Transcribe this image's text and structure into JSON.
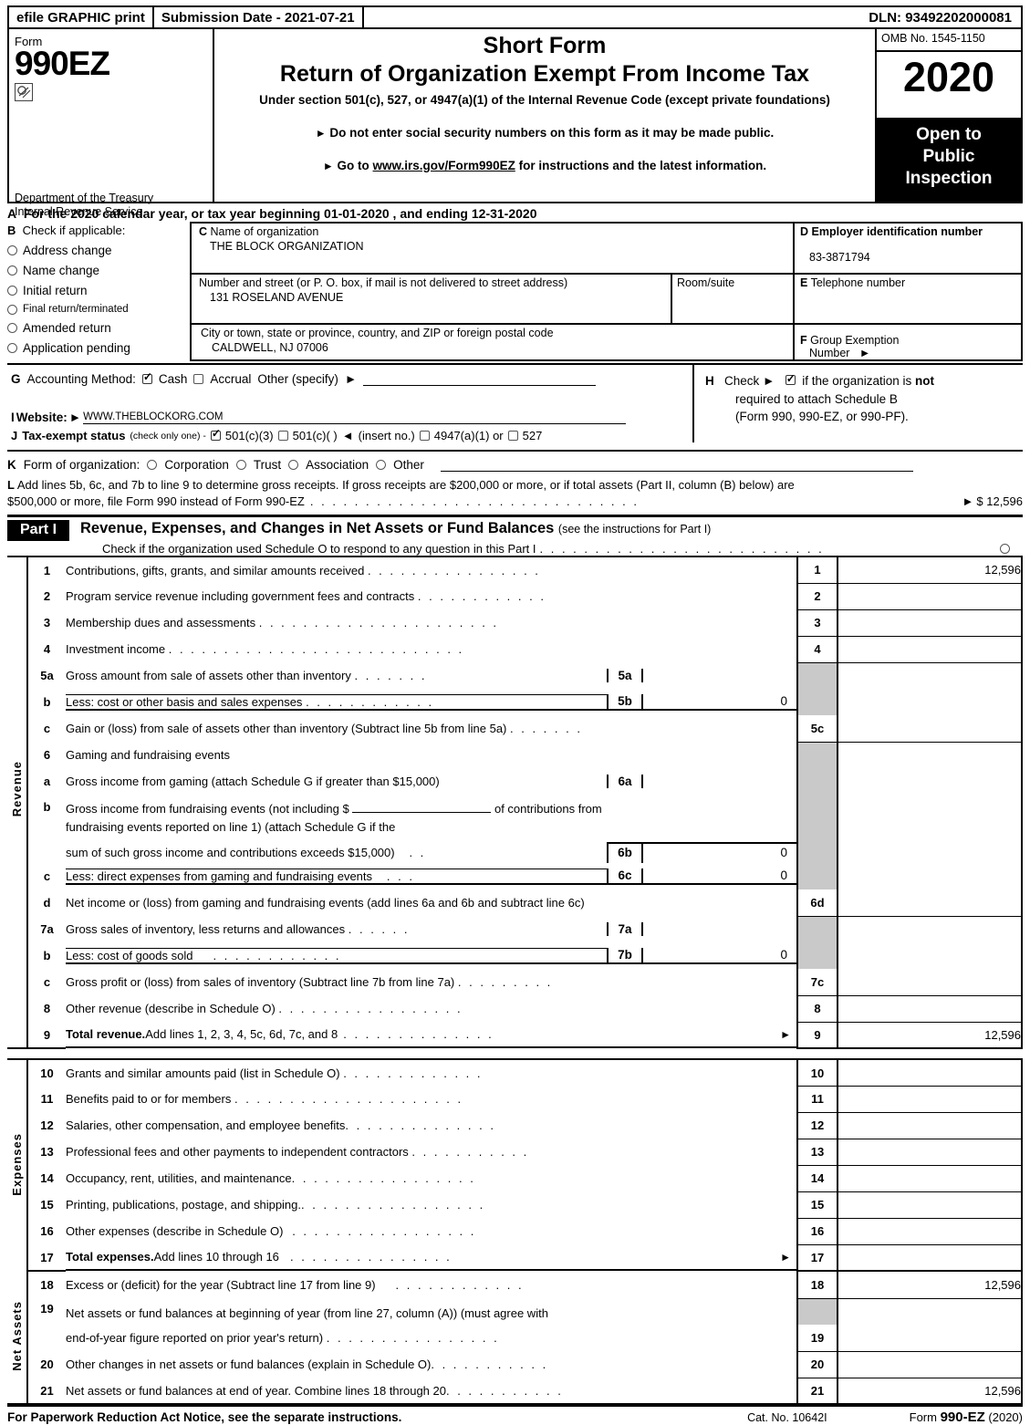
{
  "efile": {
    "graphic_print": "efile GRAPHIC print",
    "submission_date": "Submission Date - 2021-07-21",
    "dln": "DLN: 93492202000081"
  },
  "masthead": {
    "form_label": "Form",
    "form_number": "990EZ",
    "department": "Department of the Treasury",
    "irs": "Internal Revenue Service",
    "title_short": "Short Form",
    "title_main": "Return of Organization Exempt From Income Tax",
    "subtitle": "Under section 501(c), 527, or 4947(a)(1) of the Internal Revenue Code (except private foundations)",
    "bullet1": "Do not enter social security numbers on this form as it may be made public.",
    "bullet2_pre": "Go to ",
    "bullet2_link": "www.irs.gov/Form990EZ",
    "bullet2_post": " for instructions and the latest information.",
    "omb": "OMB No. 1545-1150",
    "year": "2020",
    "open_to": "Open to",
    "public": "Public",
    "inspection": "Inspection"
  },
  "lineA": {
    "letter": "A",
    "text": "For the 2020 calendar year, or tax year beginning 01-01-2020 , and ending 12-31-2020"
  },
  "lineB": {
    "letter": "B",
    "header": "Check if applicable:",
    "items": [
      {
        "label": "Address change",
        "checked": false
      },
      {
        "label": "Name change",
        "checked": false
      },
      {
        "label": "Initial return",
        "checked": false
      },
      {
        "label": "Final return/terminated",
        "checked": false
      },
      {
        "label": "Amended return",
        "checked": false
      },
      {
        "label": "Application pending",
        "checked": false
      }
    ]
  },
  "org": {
    "c_label": "Name of organization",
    "c_letter": "C",
    "name": "THE BLOCK ORGANIZATION",
    "street_label": "Number and street (or P. O. box, if mail is not delivered to street address)",
    "street": "131 ROSELAND AVENUE",
    "room_label": "Room/suite",
    "room": "",
    "city_label": "City or town, state or province, country, and ZIP or foreign postal code",
    "city": "CALDWELL, NJ   07006",
    "d_letter": "D",
    "d_label": "Employer identification number",
    "ein": "83-3871794",
    "e_letter": "E",
    "e_label": "Telephone number",
    "phone": "",
    "f_letter": "F",
    "f_label": "Group Exemption",
    "f_label2": "Number",
    "group_exemption": ""
  },
  "lineG": {
    "letter": "G",
    "label": "Accounting Method:",
    "cash": "Cash",
    "cash_checked": true,
    "accrual": "Accrual",
    "accrual_checked": false,
    "other": "Other (specify)",
    "other_value": ""
  },
  "lineH": {
    "letter": "H",
    "check_word": "Check",
    "checked": true,
    "text1_a": "if the organization is ",
    "text1_b": "not",
    "text2": "required to attach Schedule B",
    "text3": "(Form 990, 990-EZ, or 990-PF)."
  },
  "lineI": {
    "letter": "I",
    "label": "Website:",
    "website": "WWW.THEBLOCKORG.COM"
  },
  "lineJ": {
    "letter": "J",
    "label": "Tax-exempt status",
    "note": "(check only one) -",
    "opt1": "501(c)(3)",
    "opt1_checked": true,
    "opt2": "501(c)(    )",
    "opt2_checked": false,
    "insert": "(insert no.)",
    "opt3": "4947(a)(1) or",
    "opt3_checked": false,
    "opt4": "527",
    "opt4_checked": false
  },
  "lineK": {
    "letter": "K",
    "label": "Form of organization:",
    "options": [
      {
        "label": "Corporation",
        "checked": false
      },
      {
        "label": "Trust",
        "checked": false
      },
      {
        "label": "Association",
        "checked": false
      },
      {
        "label": "Other",
        "checked": false
      }
    ]
  },
  "lineL": {
    "letter": "L",
    "text1": "Add lines 5b, 6c, and 7b to line 9 to determine gross receipts. If gross receipts are $200,000 or more, or if total assets (Part II, column (B) below) are",
    "text2": "$500,000 or more, file Form 990 instead of Form 990-EZ",
    "amount": "$ 12,596"
  },
  "partI": {
    "tag": "Part I",
    "title": "Revenue, Expenses, and Changes in Net Assets or Fund Balances",
    "title_note": "(see the instructions for Part I)",
    "schedule_o": "Check if the organization used Schedule O to respond to any question in this Part I",
    "schedule_o_checked": false
  },
  "sections": {
    "revenue_label": "Revenue",
    "expenses_label": "Expenses",
    "netassets_label": "Net Assets"
  },
  "rows": {
    "r1": {
      "num": "1",
      "desc": "Contributions, gifts, grants, and similar amounts received",
      "code": "1",
      "amount": "12,596"
    },
    "r2": {
      "num": "2",
      "desc": "Program service revenue including government fees and contracts",
      "code": "2",
      "amount": ""
    },
    "r3": {
      "num": "3",
      "desc": "Membership dues and assessments",
      "code": "3",
      "amount": ""
    },
    "r4": {
      "num": "4",
      "desc": "Investment income",
      "code": "4",
      "amount": ""
    },
    "r5a": {
      "num": "5a",
      "desc": "Gross amount from sale of assets other than inventory",
      "code": "5a",
      "amount": ""
    },
    "r5b": {
      "num": "b",
      "desc": "Less: cost or other basis and sales expenses",
      "code": "5b",
      "amount": "0"
    },
    "r5c": {
      "num": "c",
      "desc": "Gain or (loss) from sale of assets other than inventory (Subtract line 5b from line 5a)",
      "code": "5c",
      "amount": ""
    },
    "r6": {
      "num": "6",
      "desc": "Gaming and fundraising events"
    },
    "r6a": {
      "num": "a",
      "desc": "Gross income from gaming (attach Schedule G if greater than $15,000)",
      "code": "6a",
      "amount": ""
    },
    "r6b": {
      "num": "b",
      "line1_pre": "Gross income from fundraising events (not including $",
      "line1_blank": "",
      "line1_post": "of contributions from",
      "line2": "fundraising events reported on line 1) (attach Schedule G if the",
      "line3": "sum of such gross income and contributions exceeds $15,000)",
      "code": "6b",
      "amount": "0"
    },
    "r6c": {
      "num": "c",
      "desc": "Less: direct expenses from gaming and fundraising events",
      "code": "6c",
      "amount": "0"
    },
    "r6d": {
      "num": "d",
      "desc": "Net income or (loss) from gaming and fundraising events (add lines 6a and 6b and subtract line 6c)",
      "code": "6d",
      "amount": ""
    },
    "r7a": {
      "num": "7a",
      "desc": "Gross sales of inventory, less returns and allowances",
      "code": "7a",
      "amount": ""
    },
    "r7b": {
      "num": "b",
      "desc": "Less: cost of goods sold",
      "code": "7b",
      "amount": "0"
    },
    "r7c": {
      "num": "c",
      "desc": "Gross profit or (loss) from sales of inventory (Subtract line 7b from line 7a)",
      "code": "7c",
      "amount": ""
    },
    "r8": {
      "num": "8",
      "desc": "Other revenue (describe in Schedule O)",
      "code": "8",
      "amount": ""
    },
    "r9": {
      "num": "9",
      "desc_bold": "Total revenue.",
      "desc": " Add lines 1, 2, 3, 4, 5c, 6d, 7c, and 8",
      "code": "9",
      "amount": "12,596"
    },
    "r10": {
      "num": "10",
      "desc": "Grants and similar amounts paid (list in Schedule O)",
      "code": "10",
      "amount": ""
    },
    "r11": {
      "num": "11",
      "desc": "Benefits paid to or for members",
      "code": "11",
      "amount": ""
    },
    "r12": {
      "num": "12",
      "desc": "Salaries, other compensation, and employee benefits",
      "code": "12",
      "amount": ""
    },
    "r13": {
      "num": "13",
      "desc": "Professional fees and other payments to independent contractors",
      "code": "13",
      "amount": ""
    },
    "r14": {
      "num": "14",
      "desc": "Occupancy, rent, utilities, and maintenance",
      "code": "14",
      "amount": ""
    },
    "r15": {
      "num": "15",
      "desc": "Printing, publications, postage, and shipping.",
      "code": "15",
      "amount": ""
    },
    "r16": {
      "num": "16",
      "desc": "Other expenses (describe in Schedule O)",
      "code": "16",
      "amount": ""
    },
    "r17": {
      "num": "17",
      "desc_bold": "Total expenses.",
      "desc": " Add lines 10 through 16",
      "code": "17",
      "amount": ""
    },
    "r18": {
      "num": "18",
      "desc": "Excess or (deficit) for the year (Subtract line 17 from line 9)",
      "code": "18",
      "amount": "12,596"
    },
    "r19": {
      "num": "19",
      "line1": "Net assets or fund balances at beginning of year (from line 27, column (A)) (must agree with",
      "line2": "end-of-year figure reported on prior year's return)",
      "code": "19",
      "amount": ""
    },
    "r20": {
      "num": "20",
      "desc": "Other changes in net assets or fund balances (explain in Schedule O)",
      "code": "20",
      "amount": ""
    },
    "r21": {
      "num": "21",
      "desc": "Net assets or fund balances at end of year. Combine lines 18 through 20",
      "code": "21",
      "amount": "12,596"
    }
  },
  "footer": {
    "notice": "For Paperwork Reduction Act Notice, see the separate instructions.",
    "cat": "Cat. No. 10642I",
    "form_pre": "Form ",
    "form_bold": "990-EZ",
    "form_post": " (2020)"
  }
}
